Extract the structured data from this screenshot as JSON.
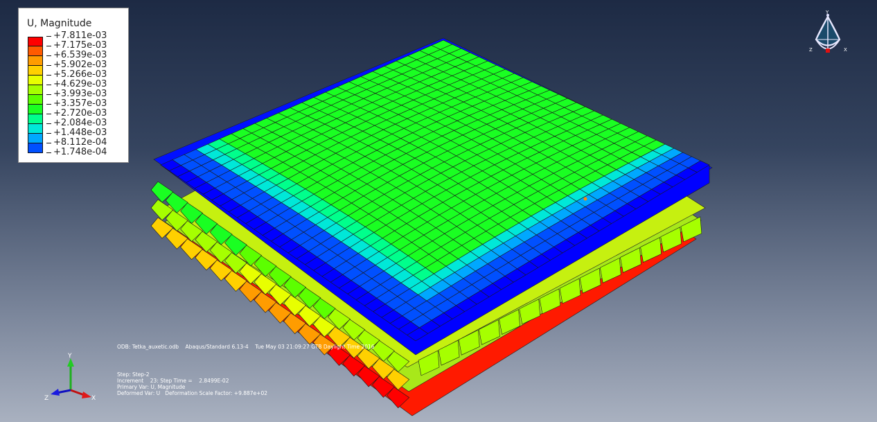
{
  "legend": {
    "title": "U, Magnitude",
    "colors": [
      "#ff0000",
      "#ff5a00",
      "#ff9c00",
      "#ffd000",
      "#e8ff00",
      "#a6ff00",
      "#5cff00",
      "#1aff22",
      "#00ff8c",
      "#00e8d8",
      "#00a8ff",
      "#0050ff",
      "#0000ff"
    ],
    "values": [
      "+7.811e-03",
      "+7.175e-03",
      "+6.539e-03",
      "+5.902e-03",
      "+5.266e-03",
      "+4.629e-03",
      "+3.993e-03",
      "+3.357e-03",
      "+2.720e-03",
      "+2.084e-03",
      "+1.448e-03",
      "+8.112e-04",
      "+1.748e-04"
    ]
  },
  "info": {
    "odb_line": "ODB: Tetka_auxetic.odb    Abaqus/Standard 6.13-4    Tue May 03 21:09:27 GTB Daylight Time 2016",
    "step_line": "Step: Step-2",
    "increment_line": "Increment    23: Step Time =    2.8499E-02",
    "primary_var_line": "Primary Var: U, Magnitude",
    "deformed_var_line": "Deformed Var: U   Deformation Scale Factor: +9.887e+02"
  },
  "triad": {
    "x_label": "X",
    "y_label": "Y",
    "z_label": "Z"
  },
  "view_cube": {
    "x_label": "X",
    "y_label": "Y",
    "z_label": "Z"
  }
}
